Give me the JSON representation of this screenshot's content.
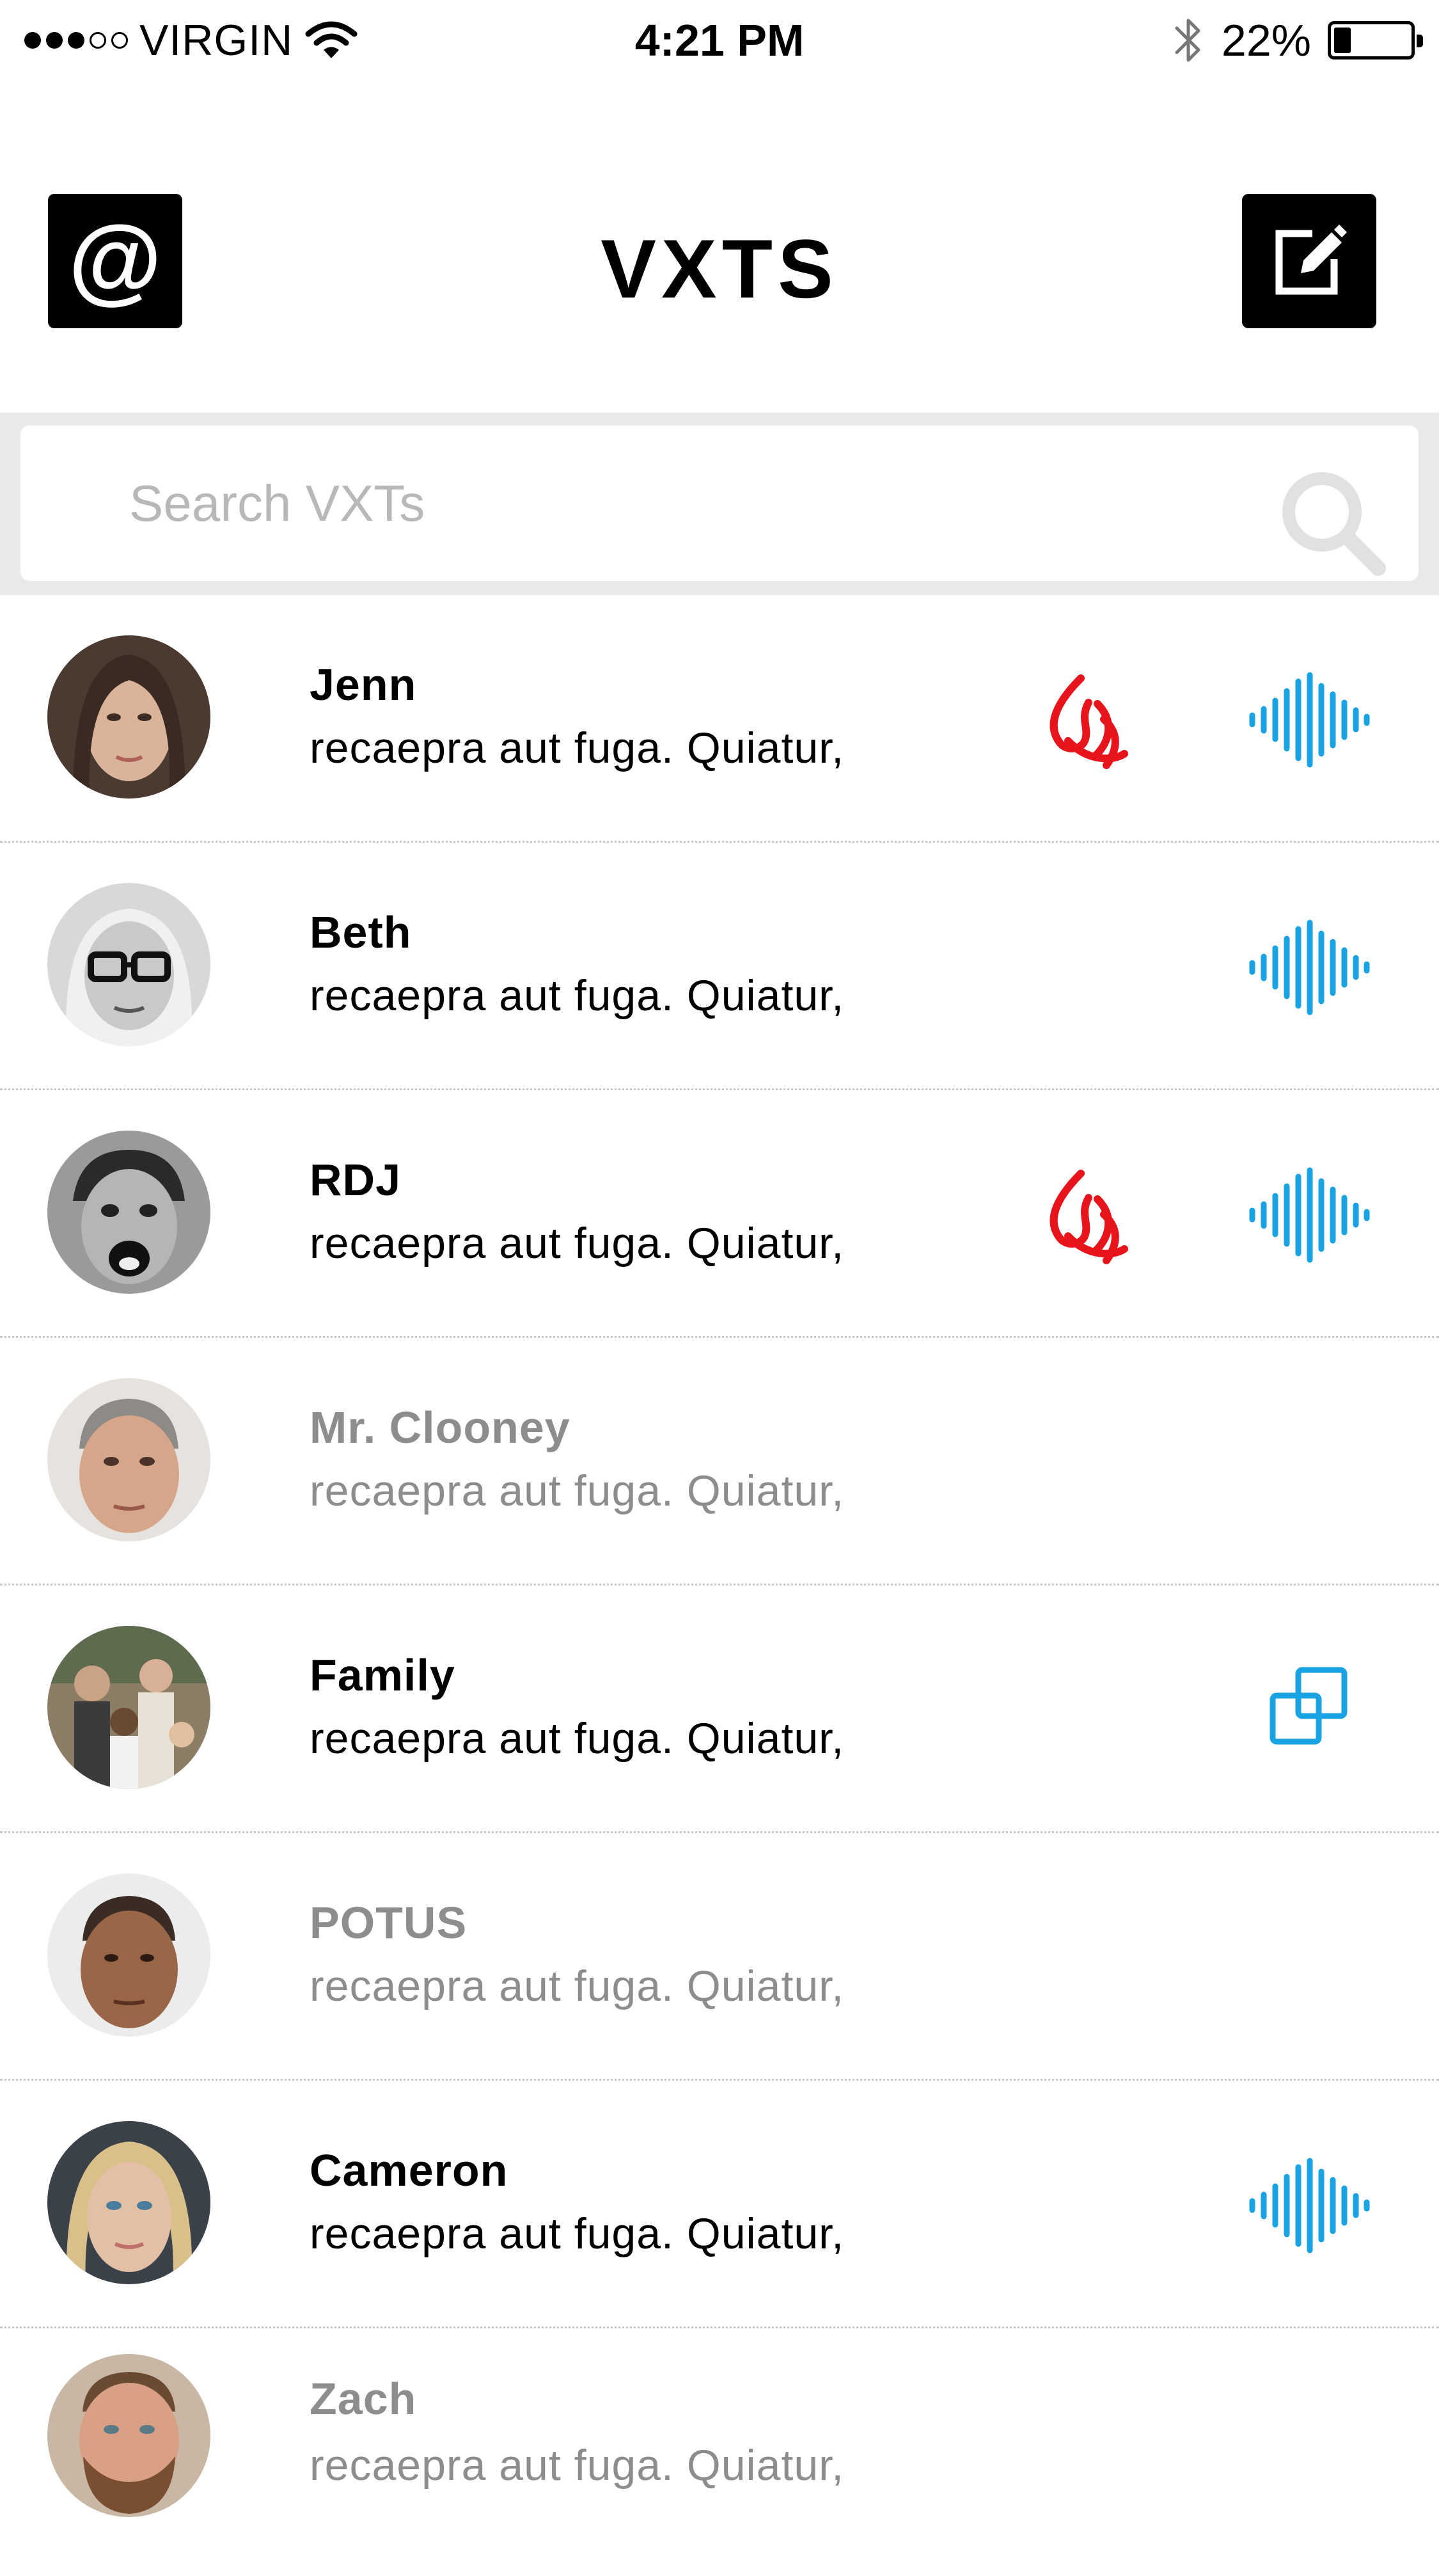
{
  "status_bar": {
    "carrier": "VIRGIN",
    "time": "4:21 PM",
    "battery_percent": "22%",
    "battery_level": 0.22,
    "signal_strength": 3,
    "signal_max": 5
  },
  "header": {
    "title": "VXTS",
    "left_button_icon": "at-sign-icon",
    "right_button_icon": "compose-icon"
  },
  "search": {
    "placeholder": "Search VXTs",
    "value": ""
  },
  "colors": {
    "flame": "#e8141b",
    "audio": "#1aa3e2",
    "read_text": "#8d8d8d"
  },
  "conversations": [
    {
      "name": "Jenn",
      "preview": "recaepra aut fuga. Quiatur,",
      "read": false,
      "icons": [
        "flame-icon",
        "audio-wave-icon"
      ]
    },
    {
      "name": "Beth",
      "preview": "recaepra aut fuga. Quiatur,",
      "read": false,
      "icons": [
        "audio-wave-icon"
      ]
    },
    {
      "name": "RDJ",
      "preview": "recaepra aut fuga. Quiatur,",
      "read": false,
      "icons": [
        "flame-icon",
        "audio-wave-icon"
      ]
    },
    {
      "name": "Mr. Clooney",
      "preview": "recaepra aut fuga. Quiatur,",
      "read": true,
      "icons": []
    },
    {
      "name": "Family",
      "preview": "recaepra aut fuga. Quiatur,",
      "read": false,
      "icons": [
        "group-icon"
      ]
    },
    {
      "name": "POTUS",
      "preview": "recaepra aut fuga. Quiatur,",
      "read": true,
      "icons": []
    },
    {
      "name": "Cameron",
      "preview": "recaepra aut fuga. Quiatur,",
      "read": false,
      "icons": [
        "audio-wave-icon"
      ]
    },
    {
      "name": "Zach",
      "preview": "recaepra aut fuga. Quiatur,",
      "read": true,
      "icons": []
    }
  ]
}
